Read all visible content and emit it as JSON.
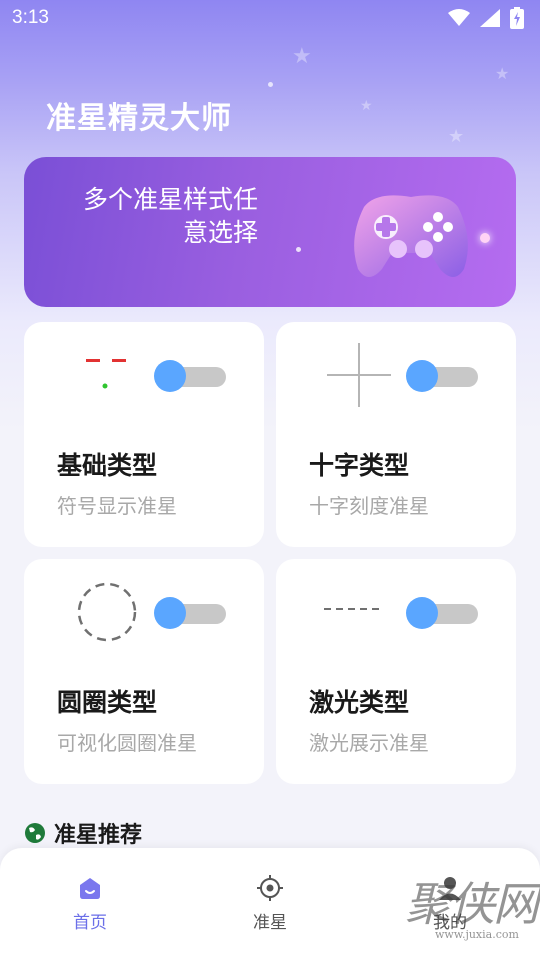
{
  "status": {
    "time": "3:13"
  },
  "app": {
    "title": "准星精灵大师"
  },
  "banner": {
    "line1": "多个准星样式任",
    "line2": "意选择",
    "image": "gamepad-illustration"
  },
  "cards": [
    {
      "title": "基础类型",
      "subtitle": "符号显示准星",
      "enabled": true,
      "preview": "basic-crosshair-icon"
    },
    {
      "title": "十字类型",
      "subtitle": "十字刻度准星",
      "enabled": true,
      "preview": "cross-crosshair-icon"
    },
    {
      "title": "圆圈类型",
      "subtitle": "可视化圆圈准星",
      "enabled": true,
      "preview": "circle-crosshair-icon"
    },
    {
      "title": "激光类型",
      "subtitle": "激光展示准星",
      "enabled": true,
      "preview": "laser-crosshair-icon"
    }
  ],
  "section": {
    "title": "准星推荐",
    "icon": "globe-icon"
  },
  "nav": [
    {
      "label": "首页",
      "icon": "home-icon",
      "active": true
    },
    {
      "label": "准星",
      "icon": "crosshair-icon",
      "active": false
    },
    {
      "label": "我的",
      "icon": "user-icon",
      "active": false
    }
  ],
  "watermark": {
    "main": "聚侠网",
    "url": "www.juxia.com"
  },
  "colors": {
    "accent": "#6b6fe8",
    "toggle_on": "#5aa6ff",
    "banner": "#9a5fe0"
  }
}
